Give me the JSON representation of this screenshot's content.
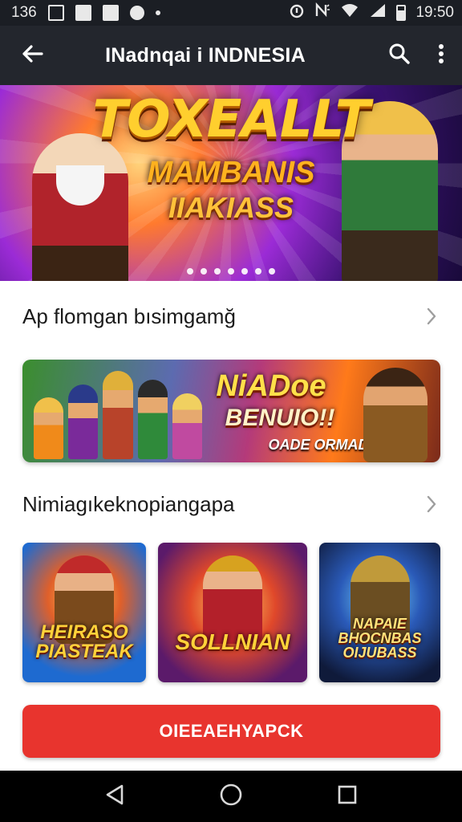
{
  "status_bar": {
    "left_text": "136",
    "time": "19:50",
    "icons": [
      "photo-icon",
      "app-icon",
      "app-icon",
      "app-icon",
      "dot-icon",
      "alarm-icon",
      "nfc-icon",
      "wifi-icon",
      "signal-icon",
      "battery-icon"
    ]
  },
  "app_bar": {
    "title": "INadnqai i INDNESIA",
    "back_icon": "back-arrow-icon",
    "search_icon": "search-icon",
    "menu_icon": "more-vert-icon"
  },
  "hero": {
    "title": "TOXEALLT",
    "subtitle_line1": "MAMBANIS",
    "subtitle_line2": "IIAKIASS",
    "pager_count": 7
  },
  "section1": {
    "label": "Ap flomgan bısimgamğ",
    "chevron_icon": "chevron-right-icon"
  },
  "banner": {
    "line1": "NiADoe",
    "line2": "BENUIO!!",
    "line3": "OADE ORMAD!"
  },
  "section2": {
    "label": "Nimiagıkeknopiangapa",
    "chevron_icon": "chevron-right-icon"
  },
  "tiles": [
    {
      "caption": "HEIRASO PIASTEAK"
    },
    {
      "caption": "SOLLNIAN"
    },
    {
      "caption": "NAPAIE BHOCNBAS OIJUBASS"
    }
  ],
  "cta": {
    "label": "OIEEAEHYAPCK"
  },
  "nav_bar": {
    "icons": [
      "back-triangle-icon",
      "home-circle-icon",
      "recents-square-icon"
    ]
  },
  "colors": {
    "status_bar_bg": "#1b1e24",
    "app_bar_bg": "#23262d",
    "cta_red": "#e8342e",
    "nav_bar_bg": "#000000"
  }
}
